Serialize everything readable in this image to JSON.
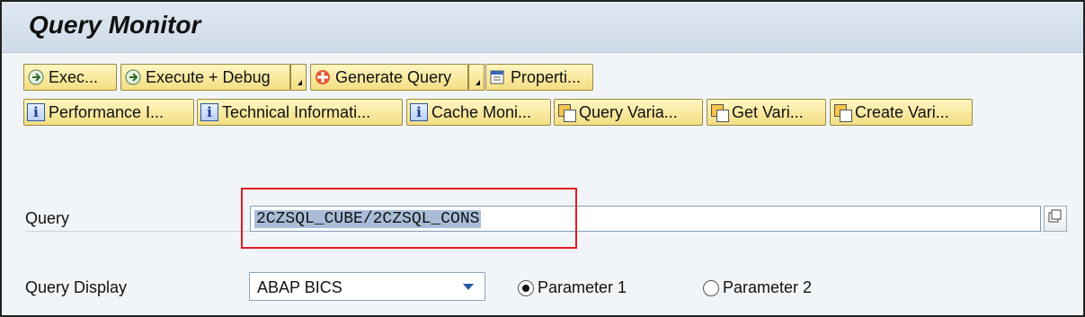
{
  "window": {
    "title": "Query Monitor"
  },
  "toolbar": {
    "row1": [
      {
        "label": "Exec...",
        "icon": "execute-icon"
      },
      {
        "label": "Execute + Debug",
        "icon": "execute-debug-icon"
      },
      {
        "label": "Generate Query",
        "icon": "generate-query-icon"
      },
      {
        "label": "Properti...",
        "icon": "properties-icon"
      }
    ],
    "row2": [
      {
        "label": "Performance I...",
        "icon": "info-icon"
      },
      {
        "label": "Technical Informati...",
        "icon": "info-icon"
      },
      {
        "label": "Cache Moni...",
        "icon": "info-icon"
      },
      {
        "label": "Query Varia...",
        "icon": "copy-icon"
      },
      {
        "label": "Get Vari...",
        "icon": "copy-icon"
      },
      {
        "label": "Create Vari...",
        "icon": "copy-icon"
      }
    ]
  },
  "form": {
    "query_label": "Query",
    "query_value": "2CZSQL_CUBE/2CZSQL_CONS",
    "display_label": "Query Display",
    "display_value": "ABAP BICS",
    "radio1": "Parameter 1",
    "radio2": "Parameter 2",
    "radio_selected": "Parameter 1"
  },
  "colors": {
    "highlight_box": "#e01e22",
    "button_bg": "#f3de82"
  }
}
